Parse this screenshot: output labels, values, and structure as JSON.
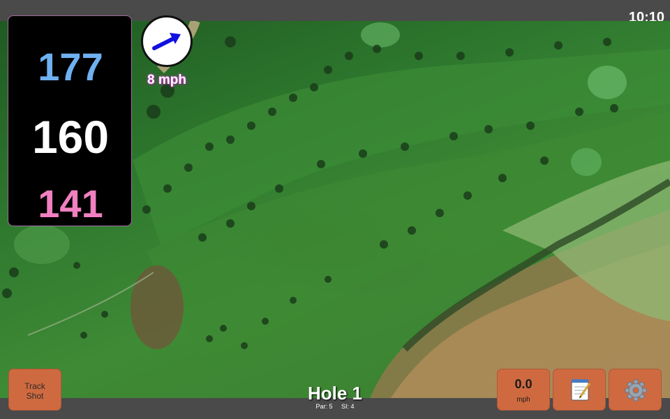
{
  "status": {
    "time": "10:10"
  },
  "distances": {
    "back": "177",
    "center": "160",
    "front": "141"
  },
  "wind": {
    "speed": "8 mph",
    "direction_icon": "arrow-icon"
  },
  "hole": {
    "title": "Hole 1",
    "par": "Par: 5",
    "si": "SI: 4"
  },
  "buttons": {
    "track_shot_line1": "Track",
    "track_shot_line2": "Shot",
    "speed_value": "0.0",
    "speed_unit": "mph",
    "notes_icon": "notepad-icon",
    "settings_icon": "gear-icon"
  },
  "colors": {
    "back": "#6fb0f0",
    "center": "#ffffff",
    "front": "#f080c0",
    "button": "#cf6a40"
  }
}
